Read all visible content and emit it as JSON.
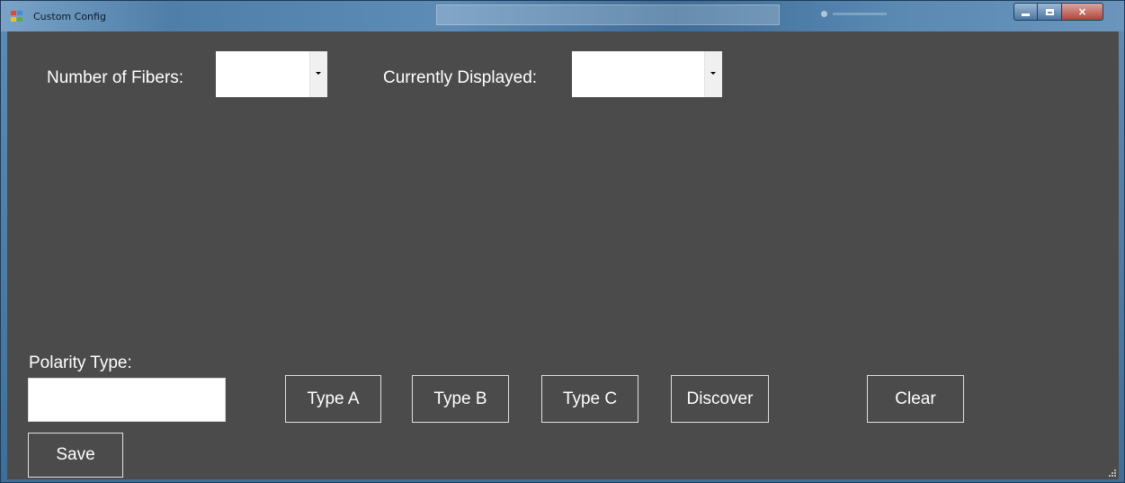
{
  "window": {
    "title": "Custom Config",
    "controls": {
      "minimize": "minimize-icon",
      "maximize": "maximize-icon",
      "close": "×"
    }
  },
  "form": {
    "fibers_label": "Number of Fibers:",
    "fibers_value": "",
    "displayed_label": "Currently Displayed:",
    "displayed_value": "",
    "polarity_label": "Polarity Type:",
    "polarity_value": "",
    "buttons": {
      "type_a": "Type A",
      "type_b": "Type B",
      "type_c": "Type C",
      "discover": "Discover",
      "clear": "Clear",
      "save": "Save"
    }
  },
  "colors": {
    "client_bg": "#4b4b4b",
    "text": "#ffffff",
    "button_border": "#e0e0e0"
  }
}
